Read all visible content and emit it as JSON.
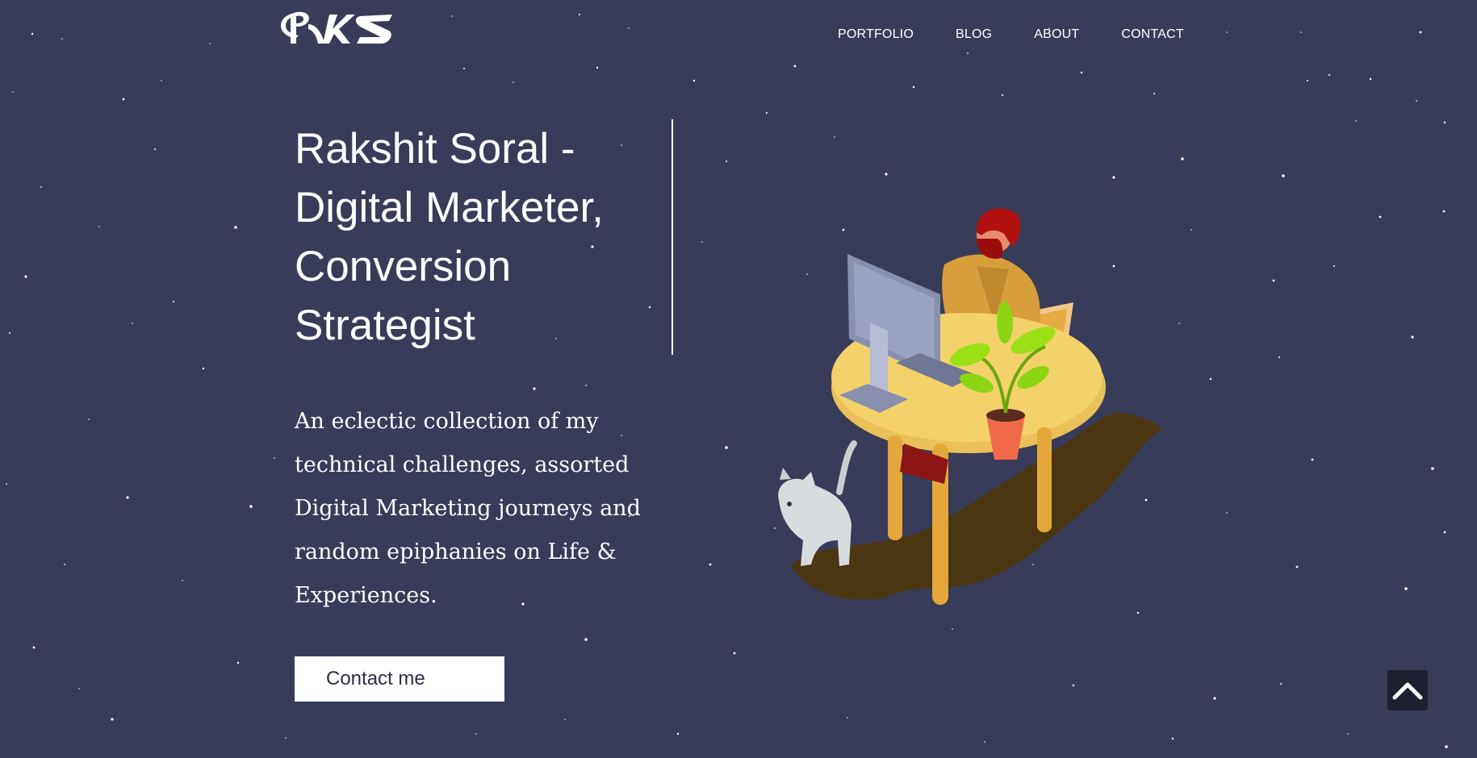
{
  "colors": {
    "background": "#393c58",
    "text": "#ffffff",
    "button_bg": "#ffffff",
    "button_text": "#2c2f45",
    "scroll_top_bg": "#1e2030"
  },
  "header": {
    "logo_icon": "rks-logo",
    "nav": [
      {
        "label": "PORTFOLIO"
      },
      {
        "label": "BLOG"
      },
      {
        "label": "ABOUT"
      },
      {
        "label": "CONTACT"
      }
    ]
  },
  "hero": {
    "title": "Rakshit Soral - Digital Marketer, Conversion Strategist",
    "description": "An eclectic collection of my technical challenges, assorted Digital Marketing journeys and random epiphanies on Life & Experiences.",
    "cta_label": "Contact me",
    "illustration_icon": "person-at-desk-illustration"
  },
  "scroll_top": {
    "icon": "chevron-up-icon"
  }
}
